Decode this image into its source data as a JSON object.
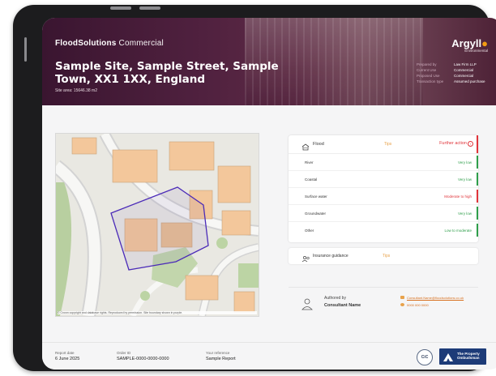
{
  "header": {
    "brand_bold": "FloodSolutions",
    "brand_light": " Commercial",
    "site_title": "Sample Site, Sample Street, Sample Town, XX1 1XX, England",
    "site_area": "Site area: 15646.38 m2",
    "logo_name": "Argyll",
    "logo_sub": "Environmental",
    "meta": [
      {
        "key": "Prepared by",
        "value": "Law Firm LLP"
      },
      {
        "key": "Current Use",
        "value": "Commercial"
      },
      {
        "key": "Proposed Use",
        "value": "Commercial"
      },
      {
        "key": "Transaction type",
        "value": "Assumed purchase"
      }
    ]
  },
  "map": {
    "caption": "© Crown copyright and database rights. Reproduced by permission. Site boundary shown in purple."
  },
  "flood": {
    "title": "Flood",
    "tip": "Tips",
    "status": "Further action",
    "rows": [
      {
        "label": "River",
        "value": "Very low",
        "level": "low"
      },
      {
        "label": "Coastal",
        "value": "Very low",
        "level": "low"
      },
      {
        "label": "Surface water",
        "value": "Moderate to high",
        "level": "high"
      },
      {
        "label": "Groundwater",
        "value": "Very low",
        "level": "low"
      },
      {
        "label": "Other",
        "value": "Low to moderate",
        "level": "low"
      }
    ]
  },
  "insurance": {
    "title": "Insurance guidance",
    "tip": "Tips"
  },
  "author": {
    "label": "Authored by",
    "name": "Consultant Name",
    "email": "Consultant.Name@floodsolutions.co.uk",
    "phone": "0000 000 0000"
  },
  "footer": {
    "report_date_label": "Report date",
    "report_date": "6 June 2025",
    "order_id_label": "Order ID",
    "order_id": "SAMPLE-0000-0000-0000",
    "reference_label": "Your reference",
    "reference": "Sample Report",
    "cic_badge": "CiC",
    "ombudsman": "The Property Ombudsman"
  },
  "colors": {
    "header_bg": "#4a1c38",
    "accent_orange": "#e8a24b",
    "risk_red": "#e0343a",
    "risk_green": "#2e9e4a"
  }
}
